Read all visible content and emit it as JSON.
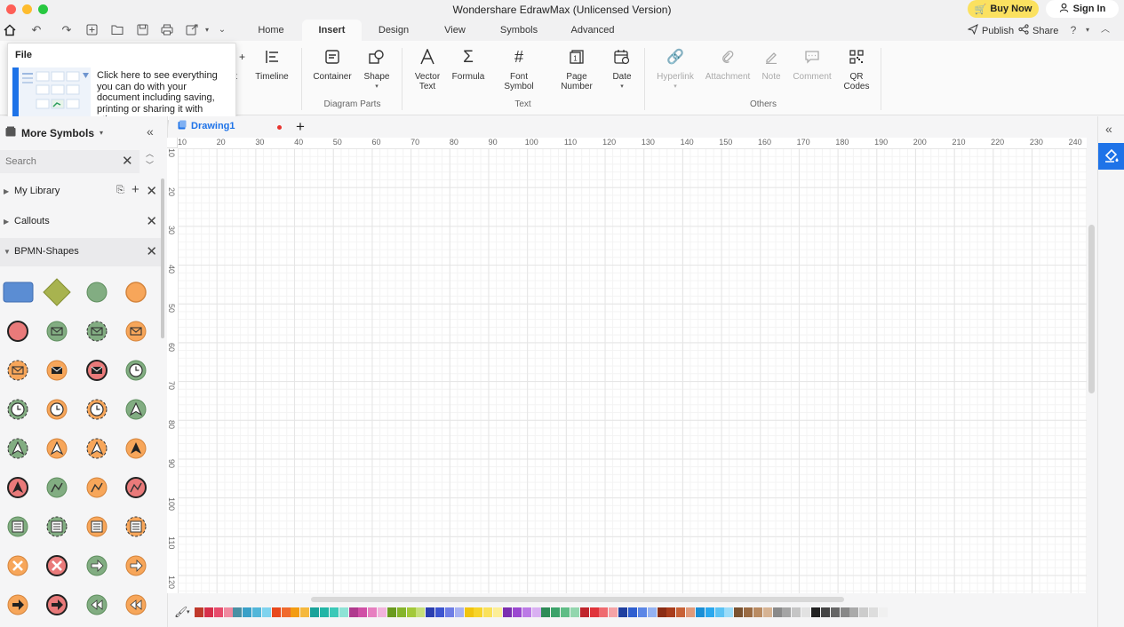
{
  "window": {
    "title": "Wondershare EdrawMax (Unlicensed Version)",
    "buy_now": "Buy Now",
    "sign_in": "Sign In"
  },
  "menu": {
    "tabs": [
      "Home",
      "Insert",
      "Design",
      "View",
      "Symbols",
      "Advanced"
    ],
    "active_tab": "Insert",
    "publish": "Publish",
    "share": "Share"
  },
  "ribbon": {
    "partial_label": "rt",
    "timeline": "Timeline",
    "container": "Container",
    "shape": "Shape",
    "vector_text": "Vector\nText",
    "formula": "Formula",
    "font_symbol": "Font\nSymbol",
    "page_number": "Page\nNumber",
    "date": "Date",
    "hyperlink": "Hyperlink",
    "attachment": "Attachment",
    "note": "Note",
    "comment": "Comment",
    "qr_codes": "QR\nCodes",
    "group_diagram_parts": "Diagram Parts",
    "group_text": "Text",
    "group_others": "Others"
  },
  "file_tooltip": {
    "title": "File",
    "description": "Click here to see everything you can do with your document including saving, printing or sharing it with others"
  },
  "left_panel": {
    "title": "More Symbols",
    "search_placeholder": "Search",
    "libraries": [
      {
        "name": "My Library",
        "expanded": false
      },
      {
        "name": "Callouts",
        "expanded": false
      },
      {
        "name": "BPMN-Shapes",
        "expanded": true
      }
    ]
  },
  "document": {
    "tab_name": "Drawing1"
  },
  "rulers": {
    "top": [
      "10",
      "20",
      "30",
      "40",
      "50",
      "60",
      "70",
      "80",
      "90",
      "100",
      "110",
      "120",
      "130",
      "140",
      "150",
      "160",
      "170",
      "180",
      "190",
      "200",
      "210",
      "220",
      "230",
      "240"
    ],
    "left": [
      "10",
      "20",
      "30",
      "40",
      "50",
      "60",
      "70",
      "80",
      "90",
      "100",
      "110",
      "120"
    ]
  },
  "colors": {
    "accent": "#1e73e8",
    "buy_now_bg": "#fbe160",
    "palette": [
      "#c0392b",
      "#d62f4a",
      "#e74c6c",
      "#f08aa0",
      "#4a90a4",
      "#3aa0c8",
      "#52b6d9",
      "#7fd3ee",
      "#e8491d",
      "#f06a2d",
      "#f39c12",
      "#f5b83d",
      "#1aa39a",
      "#22b5a6",
      "#3cc9b8",
      "#8ee3d6",
      "#b03a8e",
      "#d04fa6",
      "#e77fc0",
      "#f2b3dc",
      "#6a9b1f",
      "#86b52c",
      "#a3c93a",
      "#c6df7a",
      "#2b3fb0",
      "#3d55d0",
      "#6f7ee6",
      "#a8b2f2",
      "#f1c40f",
      "#f7d42a",
      "#fae15a",
      "#fcee96",
      "#7b2fb0",
      "#9b48d0",
      "#bc7ae6",
      "#d9b0f2",
      "#2e8b57",
      "#3ca36a",
      "#5fbd86",
      "#93d6ae",
      "#c0262d",
      "#e0343b",
      "#ef6a6f",
      "#f5a3a6",
      "#1f3f9f",
      "#2f5fd0",
      "#5b86e6",
      "#94b2f2",
      "#8b2d14",
      "#a93d1c",
      "#c86237",
      "#e09a7a",
      "#1a8fd6",
      "#2aa8ee",
      "#5cc3f4",
      "#9bdcf9",
      "#7a5230",
      "#9a6b43",
      "#b98b62",
      "#d6b393",
      "#8a8a8a",
      "#a5a5a5",
      "#c5c5c5",
      "#e2e2e2",
      "#222222",
      "#444444",
      "#666666",
      "#888888",
      "#aaaaaa",
      "#cccccc",
      "#dddddd",
      "#f0f0f0"
    ]
  }
}
